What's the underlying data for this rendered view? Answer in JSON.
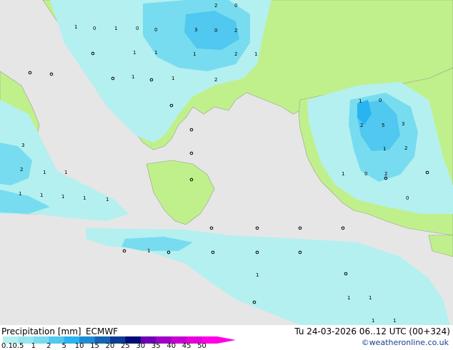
{
  "header": {
    "title": "Precipitation [mm]",
    "model": "ECMWF",
    "valid_time": "Tu 24-03-2026 06..12 UTC (00+324)",
    "credit": "©weatheronline.co.uk"
  },
  "legend": {
    "ticks": [
      "0.1",
      "0.5",
      "1",
      "2",
      "5",
      "10",
      "15",
      "20",
      "25",
      "30",
      "35",
      "40",
      "45",
      "50"
    ],
    "colors": [
      "#b4f0f0",
      "#96e6f0",
      "#78dcf0",
      "#50c8f0",
      "#28b4f0",
      "#1e8cd2",
      "#1464b4",
      "#0a3c96",
      "#000a78",
      "#6e00b4",
      "#a000c8",
      "#c800d2",
      "#e600dc",
      "#ff00e6"
    ]
  },
  "map": {
    "sea_color": "#e6e6e6",
    "land_color": "#c0f08c",
    "precip_light": "#b4f0f0",
    "precip_medium": "#78dcf0",
    "precip_heavy": "#50c8f0",
    "precip_heavier": "#28b4f0",
    "value_labels": [
      "0",
      "1",
      "2",
      "3",
      "5"
    ]
  }
}
